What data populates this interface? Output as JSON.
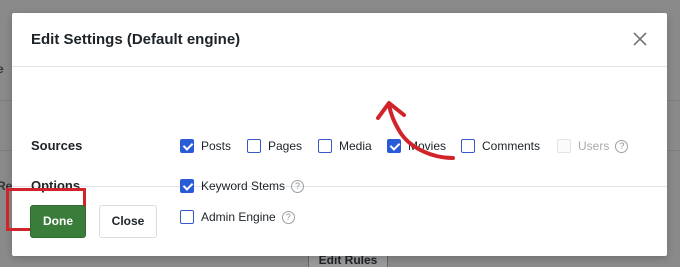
{
  "background": {
    "fragments": [
      "e",
      "Re"
    ],
    "button_label": "Edit Rules"
  },
  "modal": {
    "title": "Edit Settings (Default engine)",
    "sources_label": "Sources",
    "options_label": "Options",
    "sources": [
      {
        "label": "Posts",
        "checked": true,
        "disabled": false
      },
      {
        "label": "Pages",
        "checked": false,
        "disabled": false
      },
      {
        "label": "Media",
        "checked": false,
        "disabled": false
      },
      {
        "label": "Movies",
        "checked": true,
        "disabled": false
      },
      {
        "label": "Comments",
        "checked": false,
        "disabled": false
      },
      {
        "label": "Users",
        "checked": false,
        "disabled": true
      }
    ],
    "options": [
      {
        "label": "Keyword Stems",
        "checked": true
      },
      {
        "label": "Admin Engine",
        "checked": false
      }
    ],
    "help_glyph": "?",
    "done_label": "Done",
    "close_label": "Close"
  },
  "colors": {
    "checkbox_accent": "#2a5bd7",
    "done_button": "#3a7c3a",
    "annotation_red": "#d0242a"
  }
}
